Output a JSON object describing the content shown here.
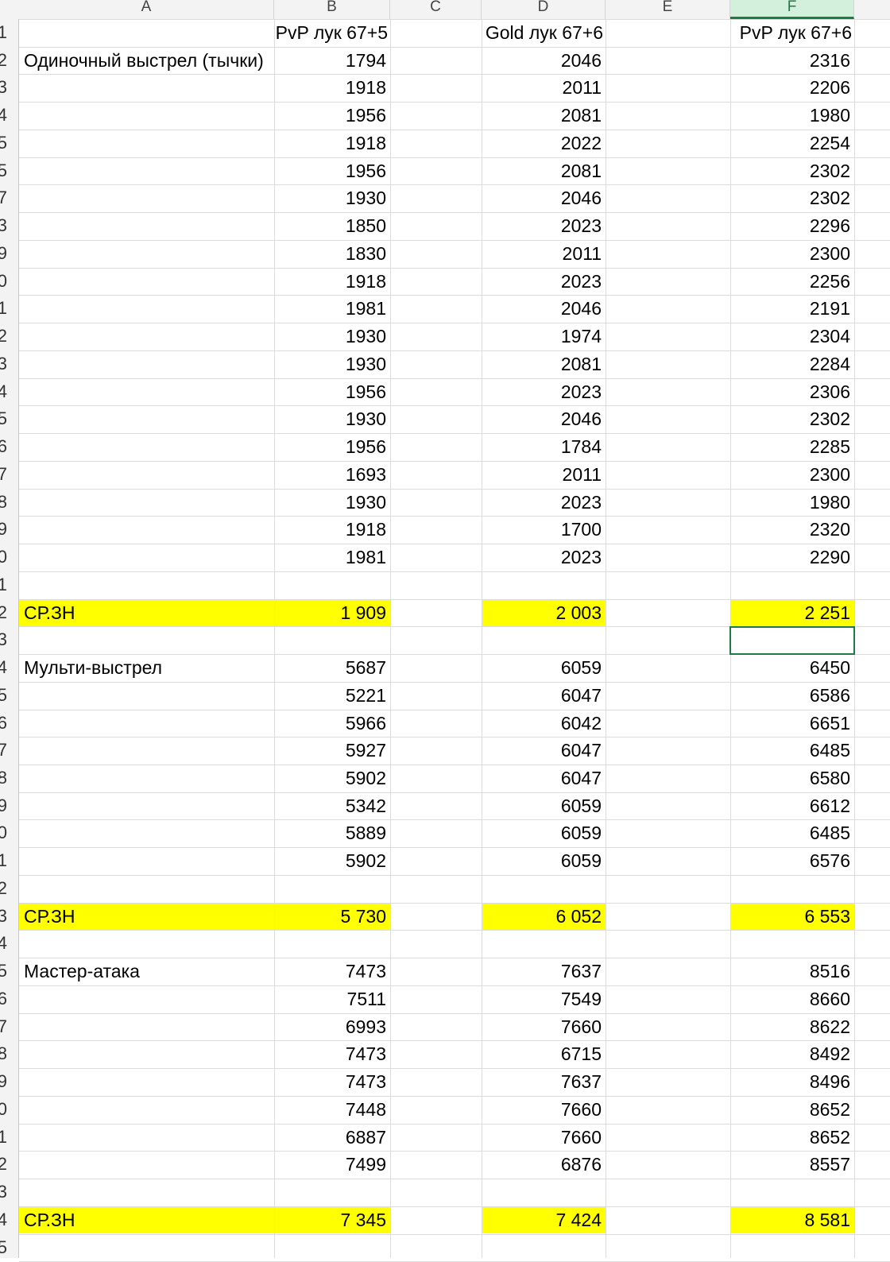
{
  "columns": [
    "A",
    "B",
    "C",
    "D",
    "E",
    "F"
  ],
  "active_column": "F",
  "row_numbers": [
    "1",
    "2",
    "3",
    "4",
    "5",
    "5",
    "7",
    "3",
    "9",
    "0",
    "1",
    "2",
    "3",
    "4",
    "5",
    "6",
    "7",
    "8",
    "9",
    "0",
    "1",
    "2",
    "3",
    "4",
    "5",
    "6",
    "7",
    "8",
    "9",
    "0",
    "1",
    "2",
    "3",
    "4",
    "5",
    "6",
    "7",
    "8",
    "9",
    "0",
    "1",
    "2",
    "3",
    "4",
    "5"
  ],
  "headers": {
    "b": "PvP лук 67+5",
    "d": "Gold лук 67+6",
    "f": "PvP лук 67+6"
  },
  "highlight_color": "#ffff00",
  "selected_cell": "F23",
  "sections": [
    {
      "label": "Одиночный выстрел (тычки)",
      "b": [
        "1794",
        "1918",
        "1956",
        "1918",
        "1956",
        "1930",
        "1850",
        "1830",
        "1918",
        "1981",
        "1930",
        "1930",
        "1956",
        "1930",
        "1956",
        "1693",
        "1930",
        "1918",
        "1981"
      ],
      "d": [
        "2046",
        "2011",
        "2081",
        "2022",
        "2081",
        "2046",
        "2023",
        "2011",
        "2023",
        "2046",
        "1974",
        "2081",
        "2023",
        "2046",
        "1784",
        "2011",
        "2023",
        "1700",
        "2023"
      ],
      "f": [
        "2316",
        "2206",
        "1980",
        "2254",
        "2302",
        "2302",
        "2296",
        "2300",
        "2256",
        "2191",
        "2304",
        "2284",
        "2306",
        "2302",
        "2285",
        "2300",
        "1980",
        "2320",
        "2290"
      ],
      "avg_label": "СР.ЗН",
      "avg": {
        "b": "1 909",
        "d": "2 003",
        "f": "2 251"
      }
    },
    {
      "label": "Мульти-выстрел",
      "b": [
        "5687",
        "5221",
        "5966",
        "5927",
        "5902",
        "5342",
        "5889",
        "5902"
      ],
      "d": [
        "6059",
        "6047",
        "6042",
        "6047",
        "6047",
        "6059",
        "6059",
        "6059"
      ],
      "f": [
        "6450",
        "6586",
        "6651",
        "6485",
        "6580",
        "6612",
        "6485",
        "6576"
      ],
      "avg_label": "СР.ЗН",
      "avg": {
        "b": "5 730",
        "d": "6 052",
        "f": "6 553"
      }
    },
    {
      "label": "Мастер-атака",
      "b": [
        "7473",
        "7511",
        "6993",
        "7473",
        "7473",
        "7448",
        "6887",
        "7499"
      ],
      "d": [
        "7637",
        "7549",
        "7660",
        "6715",
        "7637",
        "7660",
        "7660",
        "6876"
      ],
      "f": [
        "8516",
        "8660",
        "8622",
        "8492",
        "8496",
        "8652",
        "8652",
        "8557"
      ],
      "avg_label": "СР.ЗН",
      "avg": {
        "b": "7 345",
        "d": "7 424",
        "f": "8 581"
      }
    }
  ]
}
